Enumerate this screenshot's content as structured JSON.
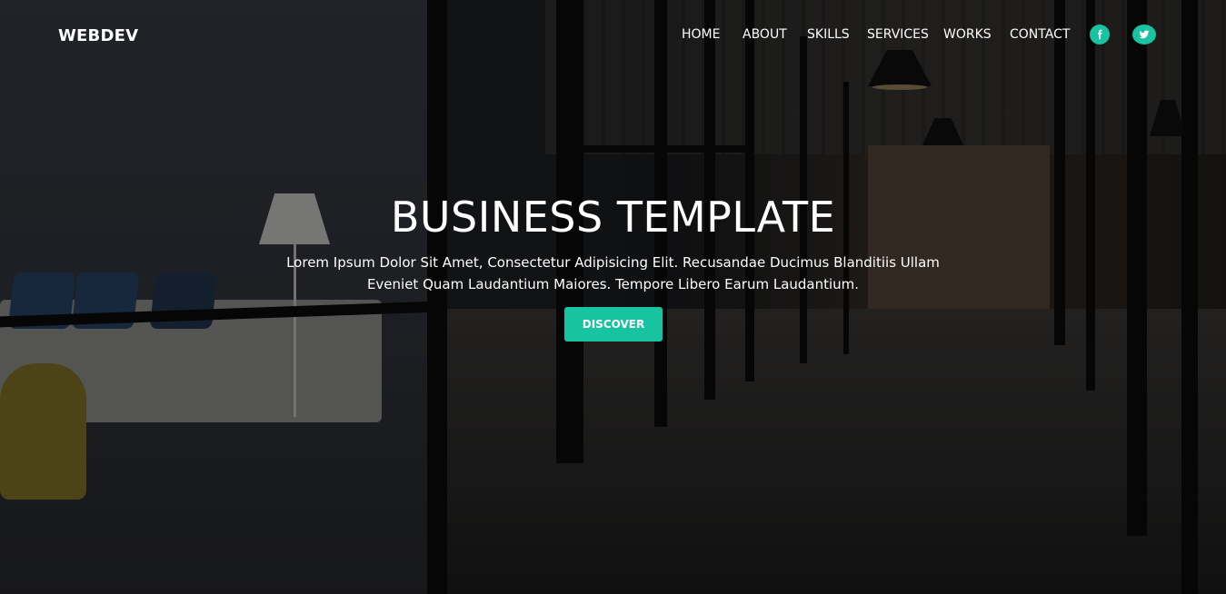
{
  "brand": "WEBDEV",
  "nav": {
    "items": [
      {
        "label": "HOME"
      },
      {
        "label": "ABOUT"
      },
      {
        "label": "SKILLS"
      },
      {
        "label": "SERVICES"
      },
      {
        "label": "WORKS"
      },
      {
        "label": "CONTACT"
      }
    ],
    "social": [
      "facebook-icon",
      "twitter-icon"
    ]
  },
  "hero": {
    "title": "BUSINESS TEMPLATE",
    "text": "Lorem Ipsum Dolor Sit Amet, Consectetur Adipisicing Elit. Recusandae Ducimus Blanditiis Ullam Eveniet Quam Laudantium Maiores. Tempore Libero Earum Laudantium.",
    "button_label": "DISCOVER"
  },
  "colors": {
    "accent": "#17c3a0",
    "text": "#ffffff"
  }
}
